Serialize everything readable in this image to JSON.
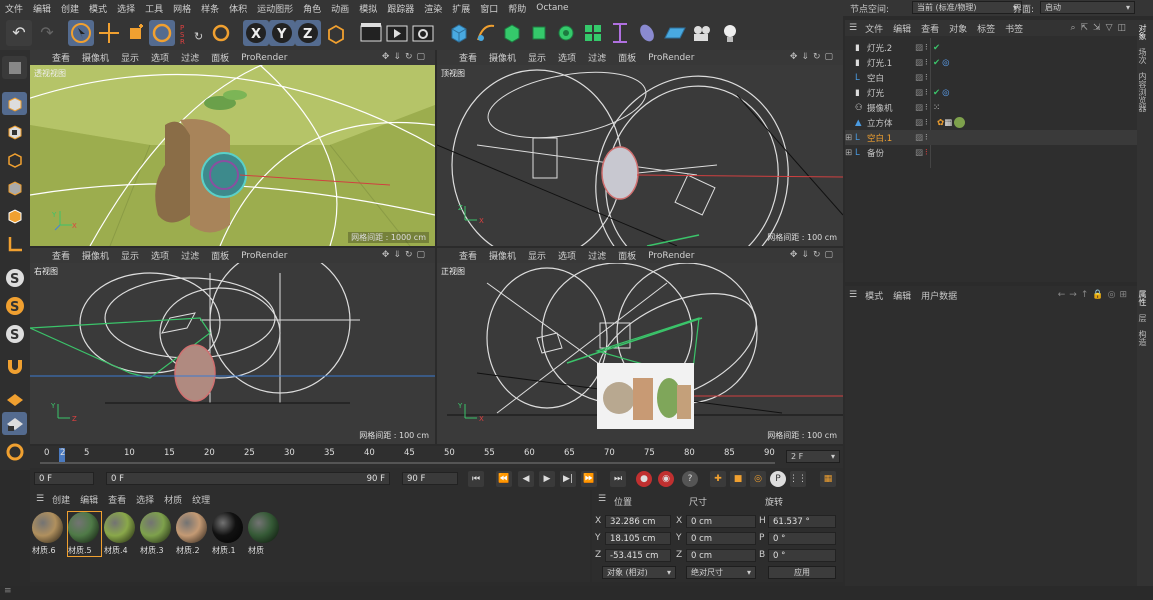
{
  "menu": [
    "文件",
    "编辑",
    "创建",
    "模式",
    "选择",
    "工具",
    "网格",
    "样条",
    "体积",
    "运动图形",
    "角色",
    "动画",
    "模拟",
    "跟踪器",
    "渲染",
    "扩展",
    "窗口",
    "帮助",
    "Octane"
  ],
  "node_space_label": "节点空间:",
  "node_space_value": "当前 (标准/物理)",
  "interface_label": "界面:",
  "interface_value": "启动",
  "viewport_menu": [
    "查看",
    "摄像机",
    "显示",
    "选项",
    "过滤",
    "面板",
    "ProRender"
  ],
  "viewports": [
    {
      "name": "透视视图",
      "grid": "网格间距 : 1000 cm"
    },
    {
      "name": "顶视图",
      "grid": "网格间距 : 100 cm"
    },
    {
      "name": "右视图",
      "grid": "网格间距 : 100 cm"
    },
    {
      "name": "正视图",
      "grid": "网格间距 : 100 cm"
    }
  ],
  "timeline": {
    "ticks": [
      "0",
      "2",
      "5",
      "10",
      "15",
      "20",
      "25",
      "30",
      "35",
      "40",
      "45",
      "50",
      "55",
      "60",
      "65",
      "70",
      "75",
      "80",
      "85",
      "90"
    ],
    "current": "2 F"
  },
  "transport": {
    "start": "0 F",
    "mid": "0 F",
    "end": "90 F",
    "end2": "90 F"
  },
  "material_menu": [
    "创建",
    "编辑",
    "查看",
    "选择",
    "材质",
    "纹理"
  ],
  "materials": [
    {
      "label": "材质.6",
      "color": "#b0905e"
    },
    {
      "label": "材质.5",
      "color": "#4f7a47"
    },
    {
      "label": "材质.4",
      "color": "#8aa84a"
    },
    {
      "label": "材质.3",
      "color": "#7ea14c"
    },
    {
      "label": "材质.2",
      "color": "#c49a74"
    },
    {
      "label": "材质.1",
      "color": "#111111"
    },
    {
      "label": "材质",
      "color": "#355a36"
    }
  ],
  "coords": {
    "headers": [
      "位置",
      "尺寸",
      "旋转"
    ],
    "rows": [
      {
        "a": "X",
        "v1": "32.286 cm",
        "b": "X",
        "v2": "0 cm",
        "c": "H",
        "v3": "61.537 °"
      },
      {
        "a": "Y",
        "v1": "18.105 cm",
        "b": "Y",
        "v2": "0 cm",
        "c": "P",
        "v3": "0 °"
      },
      {
        "a": "Z",
        "v1": "-53.415 cm",
        "b": "Z",
        "v2": "0 cm",
        "c": "B",
        "v3": "0 °"
      }
    ],
    "mode": "对象 (相对)",
    "size_mode": "绝对尺寸",
    "apply": "应用"
  },
  "object_menu": [
    "文件",
    "编辑",
    "查看",
    "对象",
    "标签",
    "书签"
  ],
  "objects": [
    {
      "name": "灯光.2",
      "highlight": false
    },
    {
      "name": "灯光.1",
      "highlight": false
    },
    {
      "name": "空白",
      "highlight": false
    },
    {
      "name": "灯光",
      "highlight": false
    },
    {
      "name": "摄像机",
      "highlight": false
    },
    {
      "name": "立方体",
      "highlight": false
    },
    {
      "name": "空白.1",
      "highlight": true
    },
    {
      "name": "备份",
      "highlight": false
    }
  ],
  "attr_menu": [
    "模式",
    "编辑",
    "用户数据"
  ],
  "side_tabs_top": [
    "对象",
    "场次",
    "内容浏览器"
  ],
  "side_tabs_bottom": [
    "属性",
    "层",
    "构造"
  ]
}
